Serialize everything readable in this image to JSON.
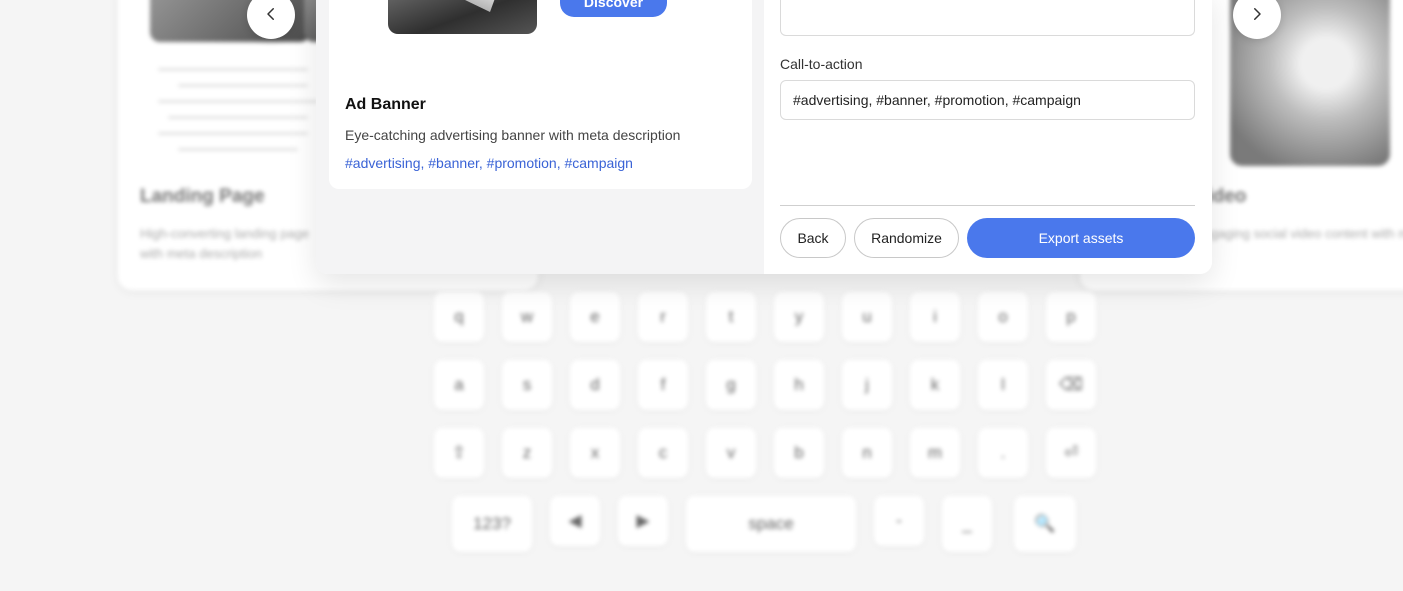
{
  "background": {
    "left_card": {
      "title": "Landing Page",
      "description_line1": "High-converting landing page",
      "description_line2": "with meta description"
    },
    "right_card": {
      "title": "Video",
      "description": "Engaging social video content with meta"
    },
    "keyboard": {
      "row1": [
        "q",
        "w",
        "e",
        "r",
        "t",
        "y",
        "u",
        "i",
        "o",
        "p"
      ],
      "row2": [
        "a",
        "s",
        "d",
        "f",
        "g",
        "h",
        "j",
        "k",
        "l",
        "⌫"
      ],
      "row3": [
        "⇧",
        "z",
        "x",
        "c",
        "v",
        "b",
        "n",
        "m",
        ".",
        "⏎"
      ],
      "row4": [
        "123?",
        "◀",
        "▶",
        "space",
        "-",
        "_",
        "🔍"
      ]
    }
  },
  "nav": {
    "prev_icon": "chevron-left-icon",
    "next_icon": "chevron-right-icon"
  },
  "preview": {
    "cta_label": "Discover",
    "title": "Ad Banner",
    "description": "Eye-catching advertising banner with meta description",
    "tags": "#advertising, #banner, #promotion, #campaign"
  },
  "form": {
    "cta_field_label": "Call-to-action",
    "cta_field_value": "#advertising, #banner, #promotion, #campaign"
  },
  "actions": {
    "back_label": "Back",
    "randomize_label": "Randomize",
    "export_label": "Export assets"
  },
  "colors": {
    "accent": "#4a78ec",
    "tag_link": "#3a63d6",
    "page_bg": "#f5f5f5"
  }
}
